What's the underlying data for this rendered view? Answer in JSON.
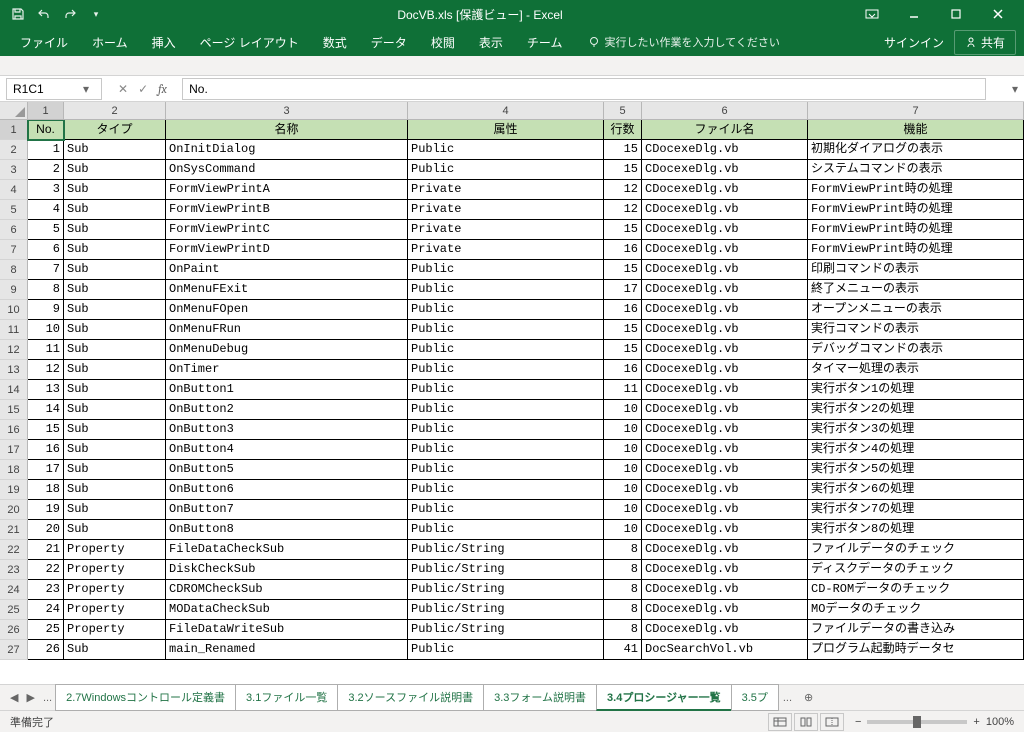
{
  "window": {
    "title": "DocVB.xls  [保護ビュー] - Excel"
  },
  "ribbon": {
    "tabs": [
      "ファイル",
      "ホーム",
      "挿入",
      "ページ レイアウト",
      "数式",
      "データ",
      "校閲",
      "表示",
      "チーム"
    ],
    "tellme": "実行したい作業を入力してください",
    "signin": "サインイン",
    "share": "共有"
  },
  "formula_bar": {
    "name_box": "R1C1",
    "formula": "No."
  },
  "column_labels": [
    "1",
    "2",
    "3",
    "4",
    "5",
    "6",
    "7"
  ],
  "headers": [
    "No.",
    "タイプ",
    "名称",
    "属性",
    "行数",
    "ファイル名",
    "機能"
  ],
  "rows": [
    {
      "no": 1,
      "type": "Sub",
      "name": "OnInitDialog",
      "attr": "Public",
      "lines": 15,
      "file": "CDocexeDlg.vb",
      "func": "初期化ダイアログの表示"
    },
    {
      "no": 2,
      "type": "Sub",
      "name": "OnSysCommand",
      "attr": "Public",
      "lines": 15,
      "file": "CDocexeDlg.vb",
      "func": "システムコマンドの表示"
    },
    {
      "no": 3,
      "type": "Sub",
      "name": "FormViewPrintA",
      "attr": "Private",
      "lines": 12,
      "file": "CDocexeDlg.vb",
      "func": "FormViewPrint時の処理"
    },
    {
      "no": 4,
      "type": "Sub",
      "name": "FormViewPrintB",
      "attr": "Private",
      "lines": 12,
      "file": "CDocexeDlg.vb",
      "func": "FormViewPrint時の処理"
    },
    {
      "no": 5,
      "type": "Sub",
      "name": "FormViewPrintC",
      "attr": "Private",
      "lines": 15,
      "file": "CDocexeDlg.vb",
      "func": "FormViewPrint時の処理"
    },
    {
      "no": 6,
      "type": "Sub",
      "name": "FormViewPrintD",
      "attr": "Private",
      "lines": 16,
      "file": "CDocexeDlg.vb",
      "func": "FormViewPrint時の処理"
    },
    {
      "no": 7,
      "type": "Sub",
      "name": "OnPaint",
      "attr": "Public",
      "lines": 15,
      "file": "CDocexeDlg.vb",
      "func": "印刷コマンドの表示"
    },
    {
      "no": 8,
      "type": "Sub",
      "name": "OnMenuFExit",
      "attr": "Public",
      "lines": 17,
      "file": "CDocexeDlg.vb",
      "func": "終了メニューの表示"
    },
    {
      "no": 9,
      "type": "Sub",
      "name": "OnMenuFOpen",
      "attr": "Public",
      "lines": 16,
      "file": "CDocexeDlg.vb",
      "func": "オープンメニューの表示"
    },
    {
      "no": 10,
      "type": "Sub",
      "name": "OnMenuFRun",
      "attr": "Public",
      "lines": 15,
      "file": "CDocexeDlg.vb",
      "func": "実行コマンドの表示"
    },
    {
      "no": 11,
      "type": "Sub",
      "name": "OnMenuDebug",
      "attr": "Public",
      "lines": 15,
      "file": "CDocexeDlg.vb",
      "func": "デバッグコマンドの表示"
    },
    {
      "no": 12,
      "type": "Sub",
      "name": "OnTimer",
      "attr": "Public",
      "lines": 16,
      "file": "CDocexeDlg.vb",
      "func": "タイマー処理の表示"
    },
    {
      "no": 13,
      "type": "Sub",
      "name": "OnButton1",
      "attr": "Public",
      "lines": 11,
      "file": "CDocexeDlg.vb",
      "func": "実行ボタン1の処理"
    },
    {
      "no": 14,
      "type": "Sub",
      "name": "OnButton2",
      "attr": "Public",
      "lines": 10,
      "file": "CDocexeDlg.vb",
      "func": "実行ボタン2の処理"
    },
    {
      "no": 15,
      "type": "Sub",
      "name": "OnButton3",
      "attr": "Public",
      "lines": 10,
      "file": "CDocexeDlg.vb",
      "func": "実行ボタン3の処理"
    },
    {
      "no": 16,
      "type": "Sub",
      "name": "OnButton4",
      "attr": "Public",
      "lines": 10,
      "file": "CDocexeDlg.vb",
      "func": "実行ボタン4の処理"
    },
    {
      "no": 17,
      "type": "Sub",
      "name": "OnButton5",
      "attr": "Public",
      "lines": 10,
      "file": "CDocexeDlg.vb",
      "func": "実行ボタン5の処理"
    },
    {
      "no": 18,
      "type": "Sub",
      "name": "OnButton6",
      "attr": "Public",
      "lines": 10,
      "file": "CDocexeDlg.vb",
      "func": "実行ボタン6の処理"
    },
    {
      "no": 19,
      "type": "Sub",
      "name": "OnButton7",
      "attr": "Public",
      "lines": 10,
      "file": "CDocexeDlg.vb",
      "func": "実行ボタン7の処理"
    },
    {
      "no": 20,
      "type": "Sub",
      "name": "OnButton8",
      "attr": "Public",
      "lines": 10,
      "file": "CDocexeDlg.vb",
      "func": "実行ボタン8の処理"
    },
    {
      "no": 21,
      "type": "Property",
      "name": "FileDataCheckSub",
      "attr": "Public/String",
      "lines": 8,
      "file": "CDocexeDlg.vb",
      "func": "ファイルデータのチェック"
    },
    {
      "no": 22,
      "type": "Property",
      "name": "DiskCheckSub",
      "attr": "Public/String",
      "lines": 8,
      "file": "CDocexeDlg.vb",
      "func": "ディスクデータのチェック"
    },
    {
      "no": 23,
      "type": "Property",
      "name": "CDROMCheckSub",
      "attr": "Public/String",
      "lines": 8,
      "file": "CDocexeDlg.vb",
      "func": "CD-ROMデータのチェック"
    },
    {
      "no": 24,
      "type": "Property",
      "name": "MODataCheckSub",
      "attr": "Public/String",
      "lines": 8,
      "file": "CDocexeDlg.vb",
      "func": "MOデータのチェック"
    },
    {
      "no": 25,
      "type": "Property",
      "name": "FileDataWriteSub",
      "attr": "Public/String",
      "lines": 8,
      "file": "CDocexeDlg.vb",
      "func": "ファイルデータの書き込み"
    },
    {
      "no": 26,
      "type": "Sub",
      "name": "main_Renamed",
      "attr": "Public",
      "lines": 41,
      "file": "DocSearchVol.vb",
      "func": "プログラム起動時データセ"
    }
  ],
  "sheet_tabs": {
    "prefix": "...",
    "items": [
      "2.7Windowsコントロール定義書",
      "3.1ファイル一覧",
      "3.2ソースファイル説明書",
      "3.3フォーム説明書",
      "3.4プロシージャー一覧",
      "3.5プ"
    ],
    "suffix": "...",
    "active_index": 4
  },
  "status": {
    "ready": "準備完了",
    "zoom": "100%"
  }
}
